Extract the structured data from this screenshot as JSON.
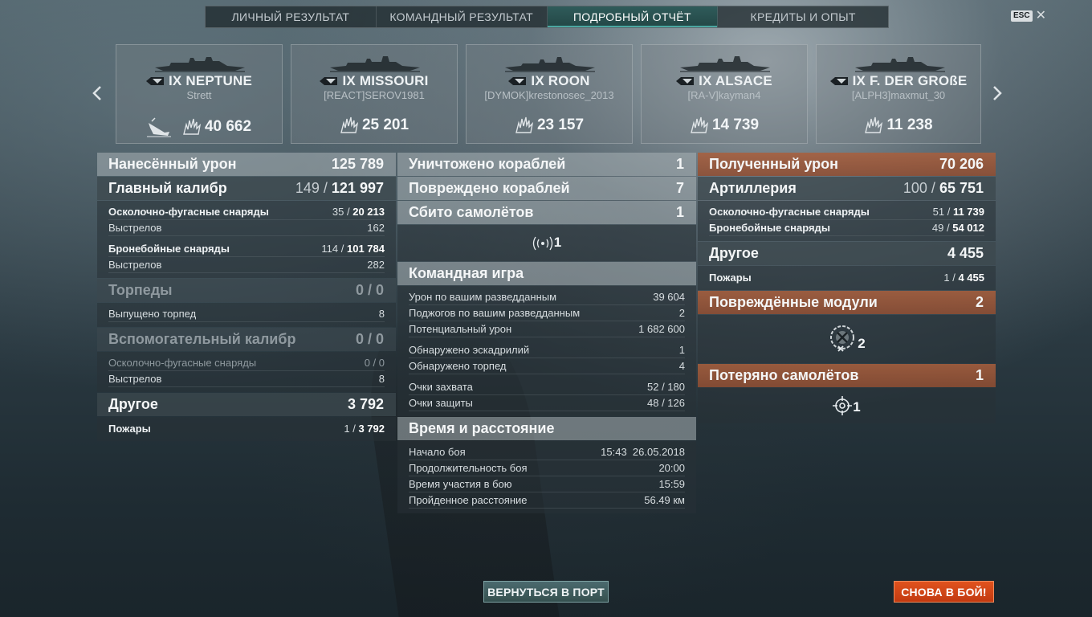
{
  "tabs": [
    "ЛИЧНЫЙ РЕЗУЛЬТАТ",
    "КОМАНДНЫЙ РЕЗУЛЬТАТ",
    "ПОДРОБНЫЙ ОТЧЁТ",
    "КРЕДИТЫ И ОПЫТ"
  ],
  "active_tab": "ПОДРОБНЫЙ ОТЧЁТ",
  "esc_label": "ESC",
  "close_glyph": "✕",
  "cards": [
    {
      "name": "IX NEPTUNE",
      "player": "Strett",
      "score": "40 662",
      "killed": true
    },
    {
      "name": "IX MISSOURI",
      "player": "[REACT]SEROV1981",
      "score": "25 201"
    },
    {
      "name": "IX ROON",
      "player": "[DYMOK]krestonosec_2013",
      "score": "23 157"
    },
    {
      "name": "IX ALSACE",
      "player": "[RA-V]kayman4",
      "score": "14 739"
    },
    {
      "name": "IX F. DER GROßE",
      "player": "[ALPH3]maxmut_30",
      "score": "11 238"
    }
  ],
  "left": {
    "dealt": {
      "label": "Нанесённый урон",
      "value": "125 789"
    },
    "main": {
      "label": "Главный калибр",
      "hits": "149",
      "value": "121 997"
    },
    "he1": {
      "label": "Осколочно-фугасные снаряды",
      "hits": "35",
      "value": "20 213"
    },
    "shots1": {
      "label": "Выстрелов",
      "value": "162"
    },
    "ap1": {
      "label": "Бронебойные снаряды",
      "hits": "114",
      "value": "101 784"
    },
    "shots2": {
      "label": "Выстрелов",
      "value": "282"
    },
    "torp": {
      "label": "Торпеды",
      "value": "0 / 0"
    },
    "torp_fired": {
      "label": "Выпущено торпед",
      "value": "8"
    },
    "sec": {
      "label": "Вспомогательный калибр",
      "value": "0 / 0"
    },
    "sec_he": {
      "label": "Осколочно-фугасные снаряды",
      "value": "0 / 0"
    },
    "sec_shots": {
      "label": "Выстрелов",
      "value": "8"
    },
    "other": {
      "label": "Другое",
      "value": "3 792"
    },
    "fires": {
      "label": "Пожары",
      "hits": "1",
      "value": "3 792"
    }
  },
  "mid": {
    "destroyed": {
      "label": "Уничтожено кораблей",
      "value": "1"
    },
    "damaged": {
      "label": "Повреждено кораблей",
      "value": "7"
    },
    "planes": {
      "label": "Сбито самолётов",
      "value": "1"
    },
    "radio_count": "1",
    "team": {
      "label": "Командная игра"
    },
    "spot_dmg": {
      "label": "Урон по вашим разведданным",
      "value": "39 604"
    },
    "spot_fires": {
      "label": "Поджогов по вашим разведданным",
      "value": "2"
    },
    "potential": {
      "label": "Потенциальный урон",
      "value": "1 682 600"
    },
    "sq_spotted": {
      "label": "Обнаружено эскадрилий",
      "value": "1"
    },
    "torp_spotted": {
      "label": "Обнаружено торпед",
      "value": "4"
    },
    "capture": {
      "label": "Очки захвата",
      "value": "52 / 180"
    },
    "defense": {
      "label": "Очки защиты",
      "value": "48 / 126"
    },
    "time": {
      "label": "Время и расстояние"
    },
    "start": {
      "label": "Начало боя",
      "time": "15:43",
      "date": "26.05.2018"
    },
    "duration": {
      "label": "Продолжительность боя",
      "value": "20:00"
    },
    "participation": {
      "label": "Время участия в бою",
      "value": "15:59"
    },
    "distance": {
      "label": "Пройденное расстояние",
      "value": "56.49 км"
    }
  },
  "right": {
    "received": {
      "label": "Полученный урон",
      "value": "70 206"
    },
    "artillery": {
      "label": "Артиллерия",
      "hits": "100",
      "value": "65 751"
    },
    "he": {
      "label": "Осколочно-фугасные снаряды",
      "hits": "51",
      "value": "11 739"
    },
    "ap": {
      "label": "Бронебойные снаряды",
      "hits": "49",
      "value": "54 012"
    },
    "other": {
      "label": "Другое",
      "value": "4 455"
    },
    "fires": {
      "label": "Пожары",
      "hits": "1",
      "value": "4 455"
    },
    "modules": {
      "label": "Повреждённые модули",
      "value": "2"
    },
    "modules_count": "2",
    "lost_planes": {
      "label": "Потеряно самолётов",
      "value": "1"
    },
    "lost_count": "1"
  },
  "buttons": {
    "port": "ВЕРНУТЬСЯ В ПОРТ",
    "battle": "СНОВА В БОЙ!"
  },
  "colors": {
    "accent": "#4ba7a1",
    "orange_header": "#a55c3b",
    "battle_button": "#d4471a"
  }
}
